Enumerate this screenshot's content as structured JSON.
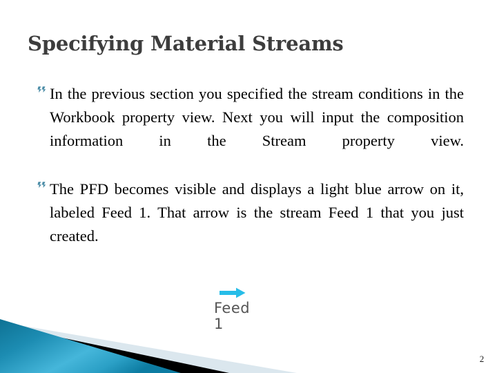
{
  "slide": {
    "title": "Specifying Material Streams",
    "page_number": "2",
    "bullets": [
      {
        "marker": "double-chevron-bullet",
        "text": "In the previous section you specified the stream conditions in the Workbook property view. Next you will input the composition information in the Stream property view."
      },
      {
        "marker": "double-chevron-bullet",
        "text": "The PFD becomes visible and displays a light blue arrow on it, labeled Feed 1. That arrow is the stream Feed 1 that you just created."
      }
    ],
    "graphic": {
      "arrow_icon": "right-arrow-icon",
      "label_name": "Feed",
      "label_number": "1"
    },
    "colors": {
      "title_text": "#3d3d3d",
      "body_text": "#000000",
      "bullet_marker": "#4a8ca6",
      "arrow_cyan": "#27bde8",
      "label_gray": "#555555",
      "decor_teal_dark": "#127a9e",
      "decor_teal_light": "#5cc3e4",
      "decor_black": "#000000",
      "decor_pale_blue": "#dbe7ee"
    }
  }
}
